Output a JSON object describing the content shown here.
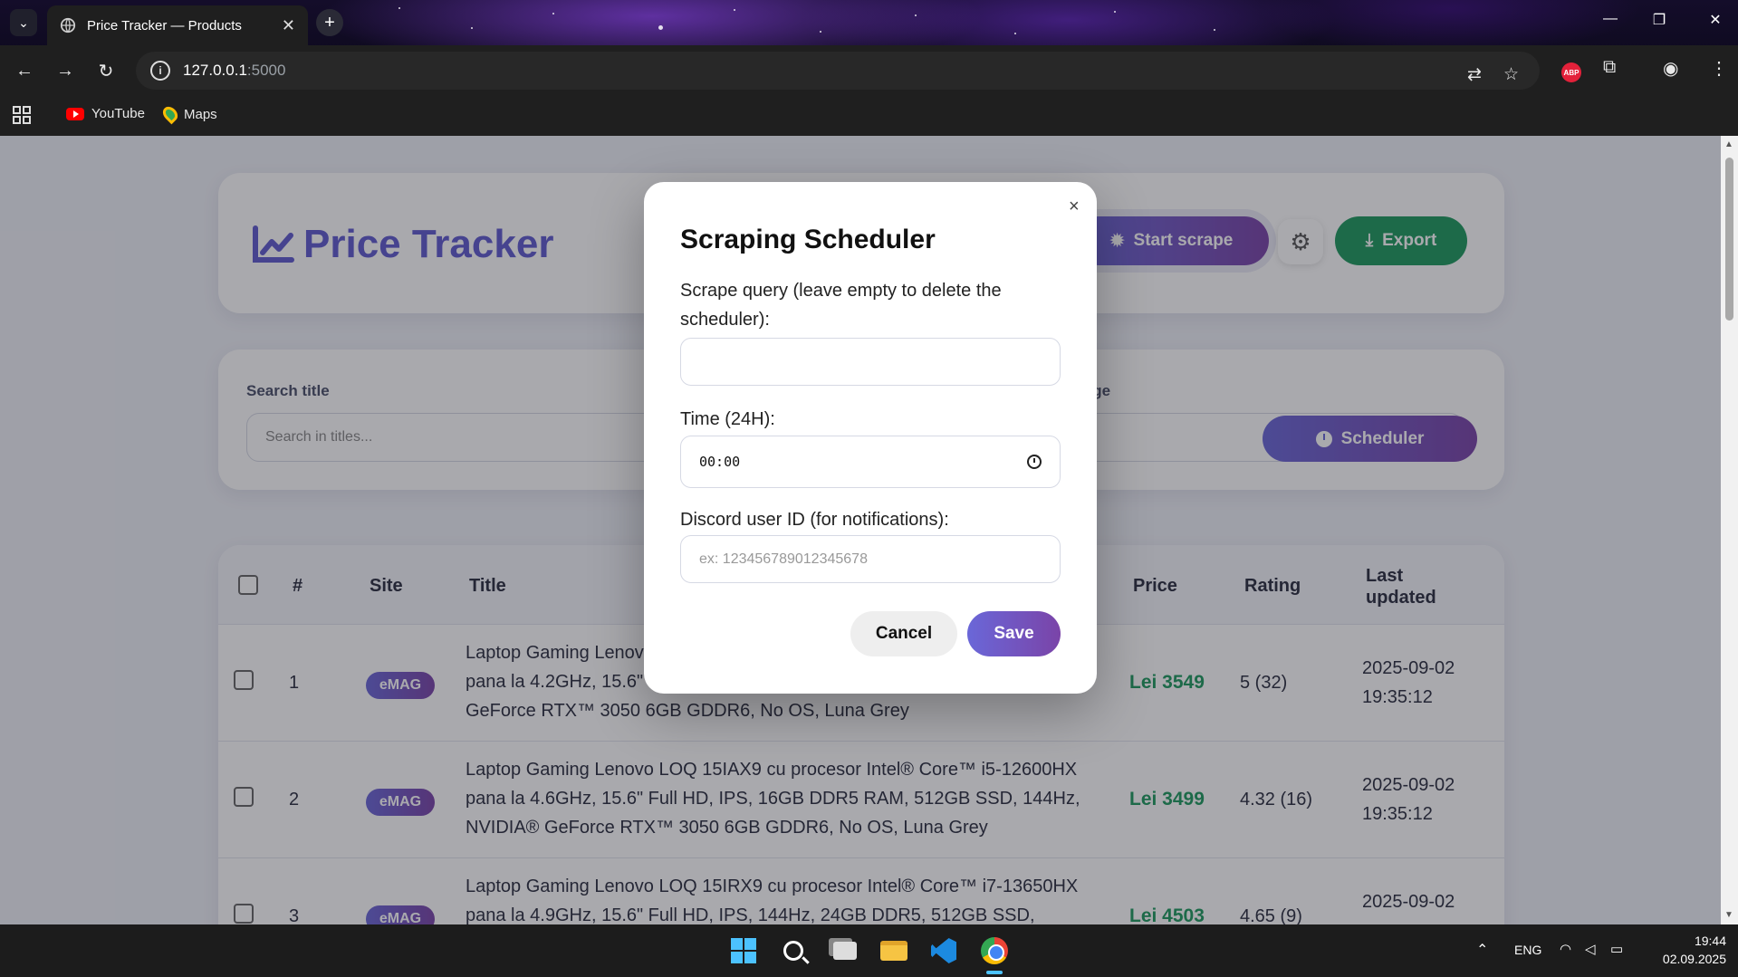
{
  "browser": {
    "tab_title": "Price Tracker — Products",
    "url_host": "127.0.0.1",
    "url_port": ":5000",
    "bookmarks": [
      "YouTube",
      "Maps"
    ],
    "abp_label": "ABP"
  },
  "header": {
    "app_title": "Price Tracker",
    "start_scrape_label": "Start scrape",
    "export_label": "Export"
  },
  "filters": {
    "search_label": "Search title",
    "search_placeholder": "Search in titles...",
    "per_page_label": "s per page",
    "scheduler_label": "Scheduler"
  },
  "table": {
    "columns": [
      "#",
      "Site",
      "Title",
      "Price",
      "Rating",
      "Last updated"
    ],
    "rows": [
      {
        "num": "1",
        "site": "eMAG",
        "title_lines": [
          "Laptop Gaming Lenov",
          "pana la 4.2GHz, 15.6\"",
          "GeForce RTX™ 3050 6GB GDDR6, No OS, Luna Grey"
        ],
        "price": "Lei 3549",
        "rating": "5 (32)",
        "updated_date": "2025-09-02",
        "updated_time": "19:35:12"
      },
      {
        "num": "2",
        "site": "eMAG",
        "title_lines": [
          "Laptop Gaming Lenovo LOQ 15IAX9 cu procesor Intel® Core™ i5-12600HX",
          "pana la 4.6GHz, 15.6\" Full HD, IPS, 16GB DDR5 RAM, 512GB SSD, 144Hz,",
          "NVIDIA® GeForce RTX™ 3050 6GB GDDR6, No OS, Luna Grey"
        ],
        "price": "Lei 3499",
        "rating": "4.32 (16)",
        "updated_date": "2025-09-02",
        "updated_time": "19:35:12"
      },
      {
        "num": "3",
        "site": "eMAG",
        "title_lines": [
          "Laptop Gaming Lenovo LOQ 15IRX9 cu procesor Intel® Core™ i7-13650HX",
          "pana la 4.9GHz, 15.6\" Full HD, IPS, 144Hz, 24GB DDR5, 512GB SSD,",
          ""
        ],
        "price": "Lei 4503",
        "rating": "4.65 (9)",
        "updated_date": "2025-09-02",
        "updated_time": ""
      }
    ]
  },
  "modal": {
    "title": "Scraping Scheduler",
    "close_symbol": "×",
    "query_label": "Scrape query (leave empty to delete the scheduler):",
    "query_value": "",
    "time_label": "Time (24H):",
    "time_value": "00:00",
    "discord_label": "Discord user ID (for notifications):",
    "discord_placeholder": "ex: 123456789012345678",
    "cancel_label": "Cancel",
    "save_label": "Save"
  },
  "taskbar": {
    "lang": "ENG",
    "time": "19:44",
    "date": "02.09.2025"
  },
  "colors": {
    "accent": "#6a67d8",
    "accent_end": "#7a44a8",
    "brand": "#5f5bcf",
    "export": "#1e9a5e",
    "price": "#1e9a5e"
  },
  "icons": [
    "globe-icon",
    "info-icon",
    "translate-icon",
    "star-icon",
    "extensions-icon",
    "profile-icon",
    "apps-grid-icon",
    "chart-line-icon",
    "bug-icon",
    "gear-icon",
    "download-icon",
    "clock-icon",
    "close-icon",
    "chevron-down-icon"
  ]
}
